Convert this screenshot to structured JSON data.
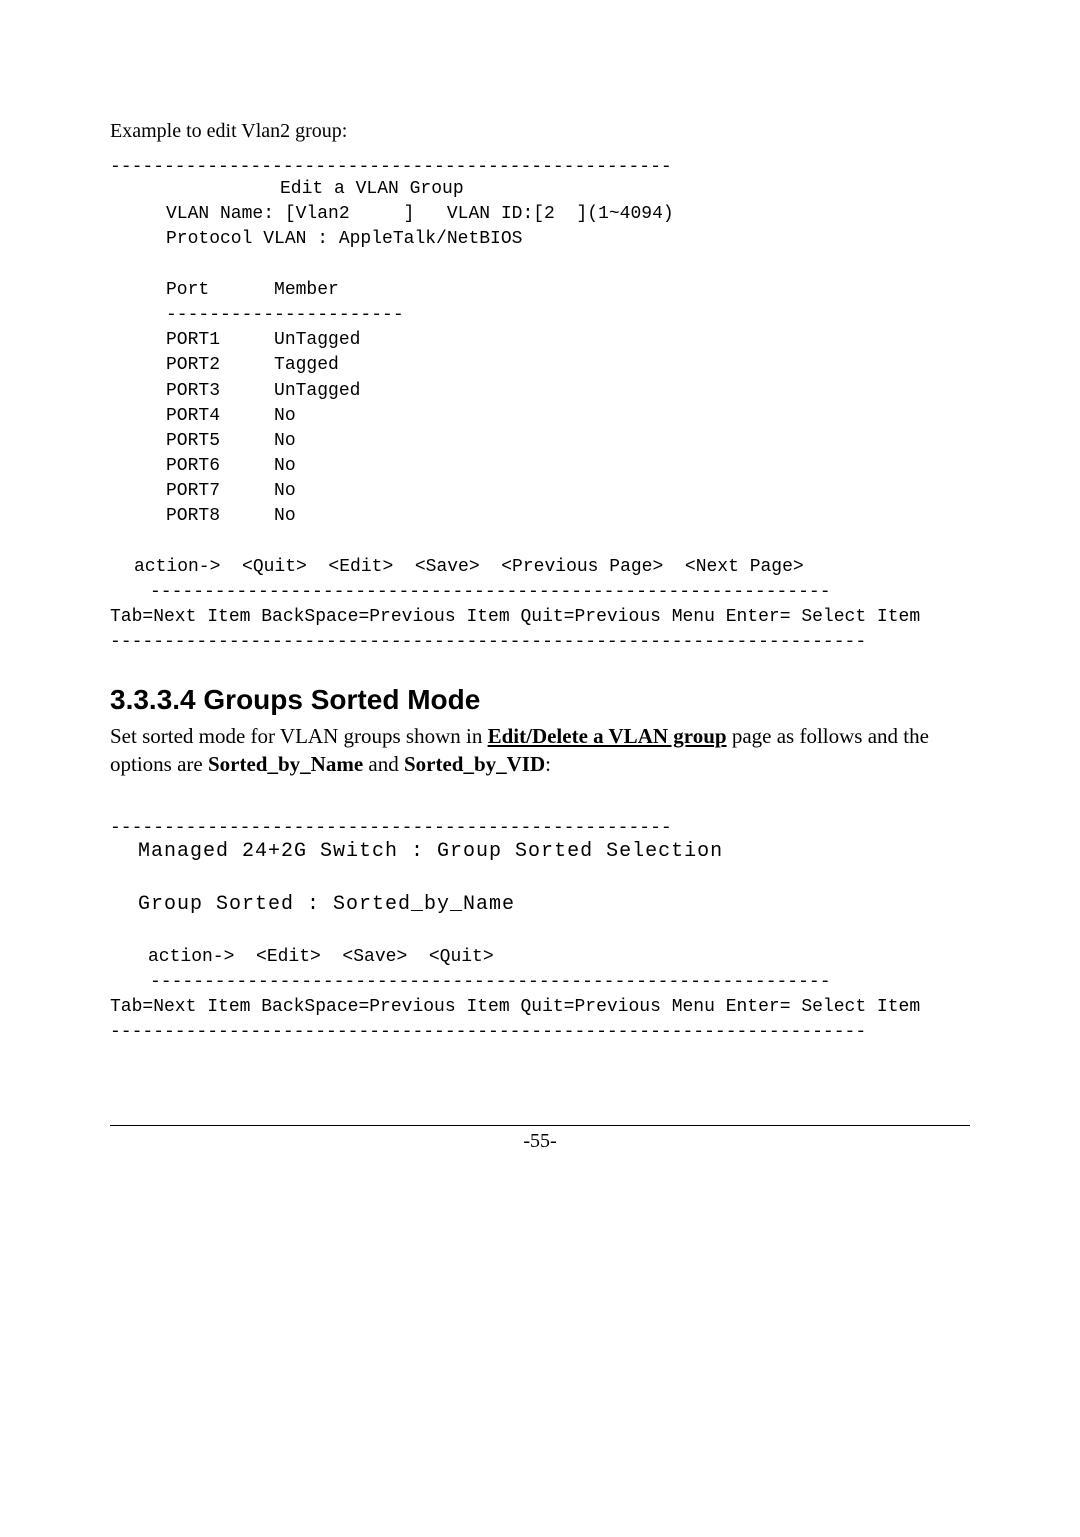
{
  "intro": "Example to edit Vlan2 group:",
  "block1": {
    "top_dash": "----------------------------------------------------",
    "title": "Edit a VLAN Group",
    "vlan_line": "VLAN Name: [Vlan2     ]   VLAN ID:[2  ](1~4094)",
    "protocol_line": "Protocol VLAN : AppleTalk/NetBIOS",
    "table_header": "Port      Member",
    "table_dash": "----------------------",
    "rows": [
      "PORT1     UnTagged",
      "PORT2     Tagged",
      "PORT3     UnTagged",
      "PORT4     No",
      "PORT5     No",
      "PORT6     No",
      "PORT7     No",
      "PORT8     No"
    ],
    "action_line": "action->  <Quit>  <Edit>  <Save>  <Previous Page>  <Next Page>",
    "inner_dash": "---------------------------------------------------------------",
    "help_line": "Tab=Next Item BackSpace=Previous Item Quit=Previous Menu Enter= Select Item",
    "bottom_dash": "----------------------------------------------------------------------"
  },
  "heading": "3.3.3.4 Groups Sorted Mode",
  "paragraph": {
    "p1": "Set sorted mode for VLAN groups shown in ",
    "p1_ul": "Edit/Delete a VLAN group",
    "p2": " page as follows and the options are ",
    "p2_b1": "Sorted_by_Name",
    "p2_mid": " and ",
    "p2_b2": "Sorted_by_VID",
    "p2_end": ":"
  },
  "block2": {
    "top_dash": "----------------------------------------------------",
    "title_line": "Managed 24+2G Switch : Group Sorted Selection",
    "sorted_line": "Group Sorted : Sorted_by_Name",
    "action_line": "action->  <Edit>  <Save>  <Quit>",
    "inner_dash": "---------------------------------------------------------------",
    "help_line": "Tab=Next Item BackSpace=Previous Item Quit=Previous Menu Enter= Select Item",
    "bottom_dash": "----------------------------------------------------------------------"
  },
  "page_number": "-55-"
}
